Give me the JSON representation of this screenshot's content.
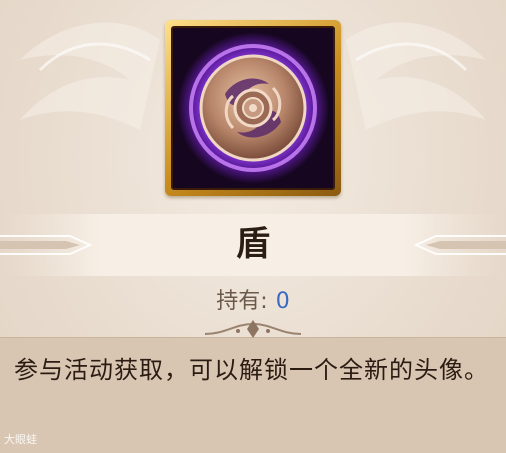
{
  "item": {
    "name": "盾",
    "icon": "shield-icon",
    "own_label": "持有:",
    "own_count": "0",
    "description": "参与活动获取，可以解锁一个全新的头像。"
  },
  "watermark": "大眼蛙",
  "colors": {
    "frame_gold": "#d9a43a",
    "aura_purple": "#a64dff",
    "count_blue": "#3a6bc4",
    "description_bg": "#d9c6b2"
  }
}
